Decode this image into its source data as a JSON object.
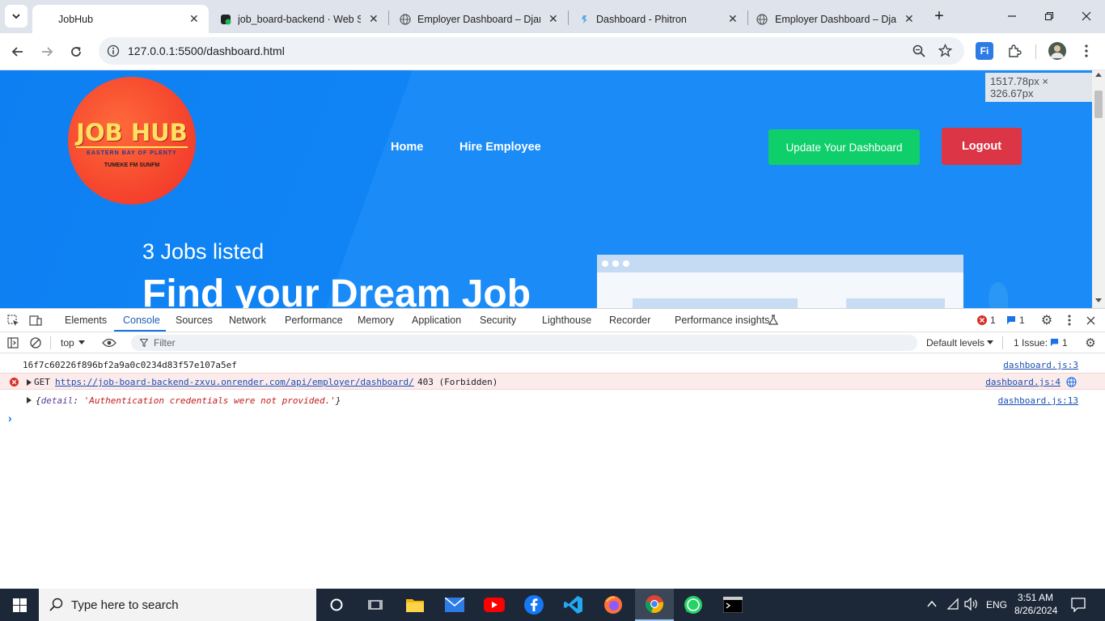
{
  "browser": {
    "tabs": [
      {
        "title": "JobHub",
        "active": true
      },
      {
        "title": "job_board-backend · Web Se"
      },
      {
        "title": "Employer Dashboard – Djang"
      },
      {
        "title": "Dashboard - Phitron"
      },
      {
        "title": "Employer Dashboard – Djang"
      }
    ],
    "new_tab_label": "+",
    "url": "127.0.0.1:5500/dashboard.html",
    "size_tooltip": "1517.78px × 326.67px"
  },
  "page": {
    "logo": {
      "title": "JOB HUB",
      "subtitle": "EASTERN BAY OF PLENTY",
      "sponsors": "TUMEKE FM   SUNFM"
    },
    "nav": {
      "home": "Home",
      "hire": "Hire Employee"
    },
    "buttons": {
      "update": "Update Your Dashboard",
      "logout": "Logout"
    },
    "jobs_listed": "3 Jobs listed",
    "hero_title": "Find your Dream Job"
  },
  "devtools": {
    "tabs": [
      "Elements",
      "Console",
      "Sources",
      "Network",
      "Performance",
      "Memory",
      "Application",
      "Security",
      "Lighthouse",
      "Recorder",
      "Performance insights"
    ],
    "active_tab": "Console",
    "error_count": "1",
    "message_count": "1",
    "context": "top",
    "filter_placeholder": "Filter",
    "levels": "Default levels",
    "issues_label": "1 Issue:",
    "issues_count": "1",
    "console": [
      {
        "text": "16f7c60226f896bf2a9a0c0234d83f57e107a5ef",
        "source": "dashboard.js:3"
      },
      {
        "method": "GET",
        "url": "https://job-board-backend-zxvu.onrender.com/api/employer/dashboard/",
        "status": "403 (Forbidden)",
        "source": "dashboard.js:4"
      },
      {
        "key": "detail",
        "value": "'Authentication credentials were not provided.'",
        "source": "dashboard.js:13"
      }
    ],
    "prompt": "›"
  },
  "taskbar": {
    "search_placeholder": "Type here to search",
    "language": "ENG",
    "time": "3:51 AM",
    "date": "8/26/2024"
  },
  "colors": {
    "page_blue": "#0d7ff2",
    "update_green": "#0fcf6a",
    "logout_red": "#dc3545",
    "logo_yellow": "#ffe160",
    "error_bg": "#fcebeb",
    "link_blue": "#1a4fb3"
  }
}
